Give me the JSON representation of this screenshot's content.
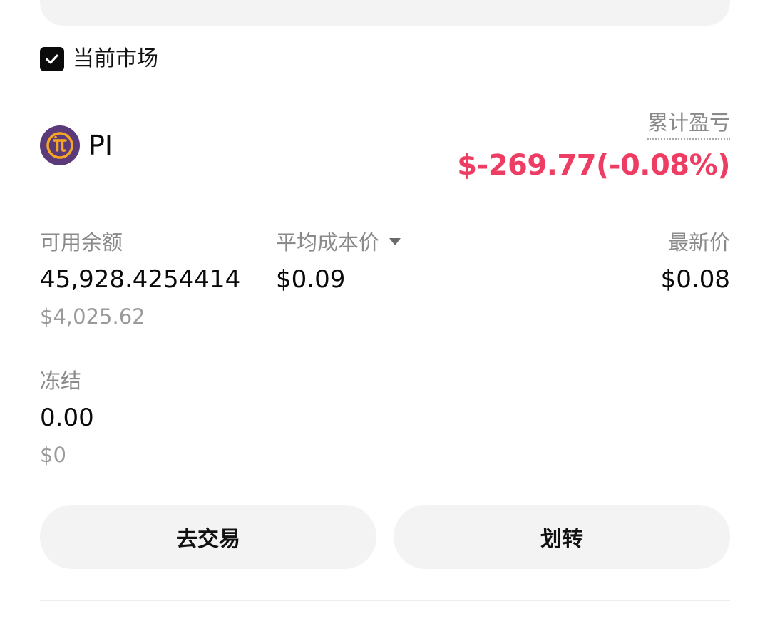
{
  "filter": {
    "current_market_label": "当前市场",
    "current_market_checked": true
  },
  "asset": {
    "symbol": "PI",
    "icon": "pi-network-logo",
    "logo_colors": {
      "outer": "#5a3a78",
      "inner": "#f6a623"
    },
    "pnl_label": "累计盈亏",
    "pnl_value": "$-269.77(-0.08%)",
    "pnl_color": "#ee3d62"
  },
  "stats": {
    "available": {
      "label": "可用余额",
      "amount": "45,928.4254414",
      "usd": "$4,025.62"
    },
    "avg_cost": {
      "label": "平均成本价",
      "value": "$0.09",
      "icon": "caret-down-icon"
    },
    "latest_price": {
      "label": "最新价",
      "value": "$0.08"
    },
    "frozen": {
      "label": "冻结",
      "amount": "0.00",
      "usd": "$0"
    }
  },
  "actions": {
    "trade_label": "去交易",
    "transfer_label": "划转"
  }
}
